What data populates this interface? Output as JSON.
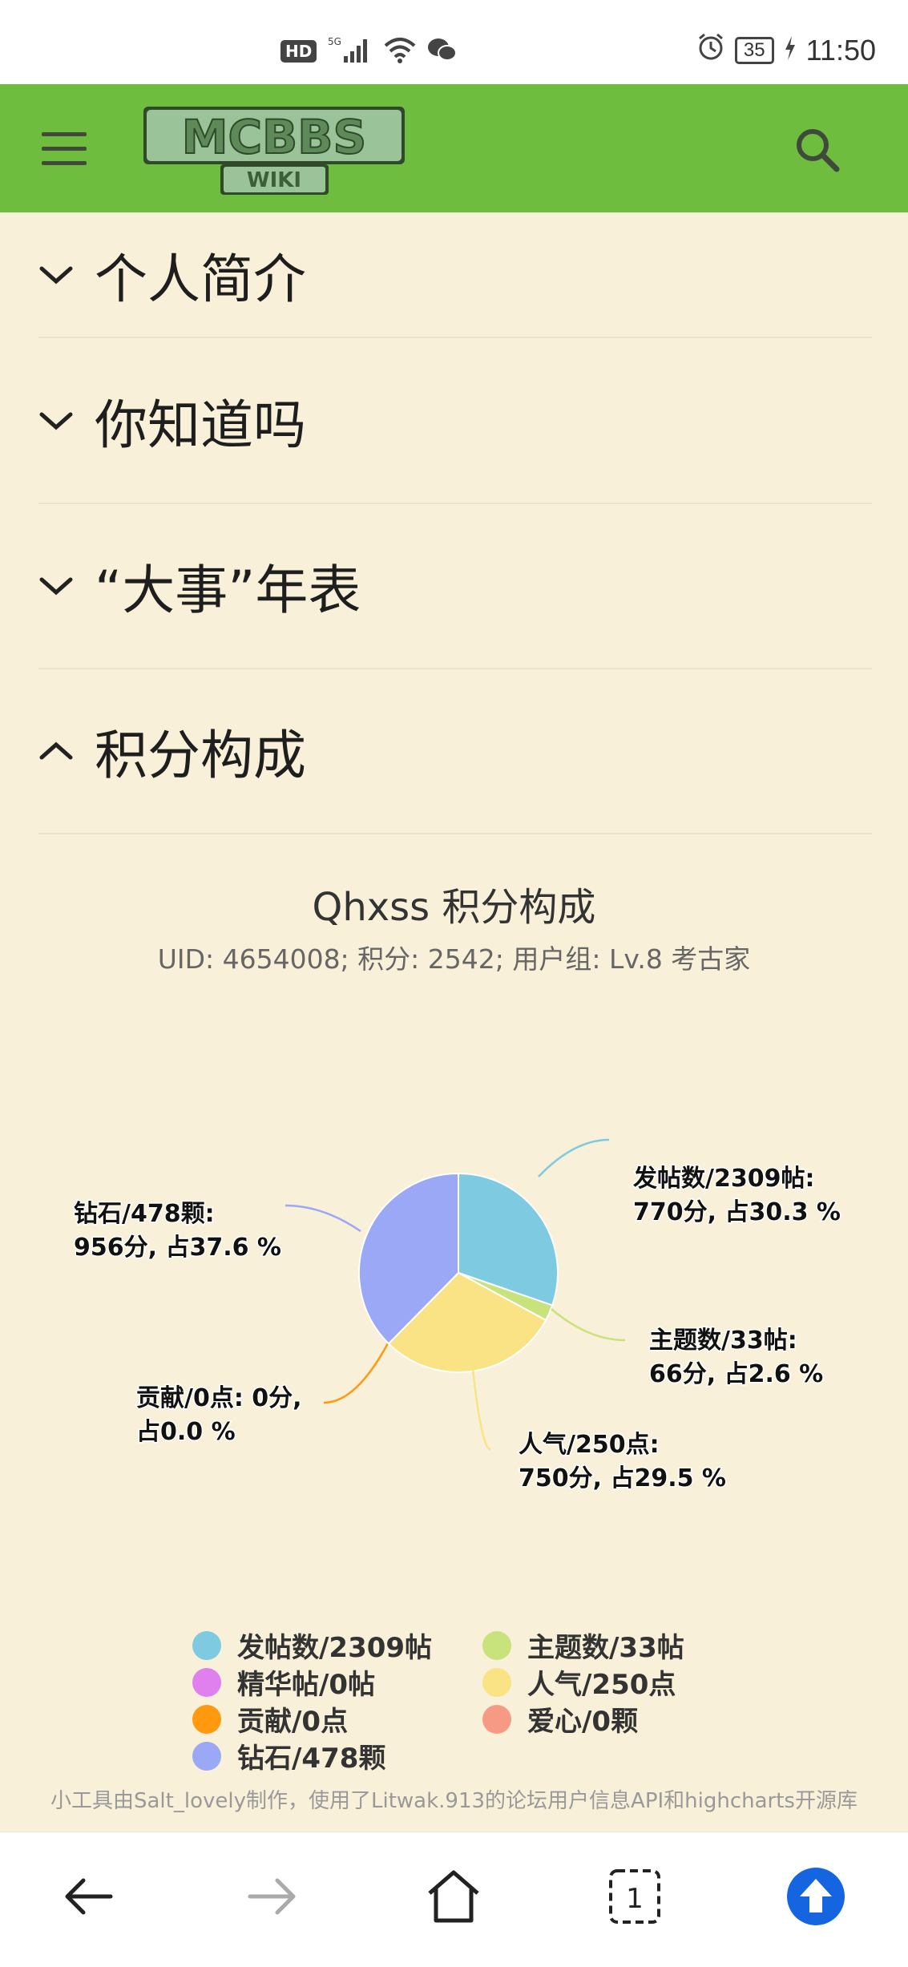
{
  "status_bar": {
    "network_badge": "HD",
    "signal_label": "5G",
    "battery": "35",
    "time": "11:50",
    "icons": [
      "hd-icon",
      "signal-icon",
      "wifi-icon",
      "wechat-icon",
      "alarm-icon",
      "battery-icon",
      "charging-icon"
    ]
  },
  "header": {
    "logo_text": "MCBBS",
    "logo_sub": "WIKI",
    "bg_color": "#6ebd3f",
    "icons": [
      "menu-icon",
      "search-icon"
    ]
  },
  "sections": [
    {
      "label": "个人简介",
      "expanded": false
    },
    {
      "label": "你知道吗",
      "expanded": false
    },
    {
      "label": "“大事”年表",
      "expanded": false
    },
    {
      "label": "积分构成",
      "expanded": true
    }
  ],
  "chart_data": {
    "type": "pie",
    "title": "Qhxss 积分构成",
    "subtitle": "UID: 4654008; 积分: 2542; 用户组: Lv.8 考古家",
    "slices": [
      {
        "name": "发帖数/2309帖",
        "points": 770,
        "percent": 30.3,
        "color": "#7ecae0",
        "label_line1": "发帖数/2309帖:",
        "label_line2": "770分, 占30.3 %"
      },
      {
        "name": "主题数/33帖",
        "points": 66,
        "percent": 2.6,
        "color": "#c8e27c",
        "label_line1": "主题数/33帖:",
        "label_line2": "66分, 占2.6 %"
      },
      {
        "name": "精华帖/0帖",
        "points": 0,
        "percent": 0.0,
        "color": "#e080ee"
      },
      {
        "name": "人气/250点",
        "points": 750,
        "percent": 29.5,
        "color": "#fae384",
        "label_line1": "人气/250点:",
        "label_line2": "750分, 占29.5 %"
      },
      {
        "name": "贡献/0点",
        "points": 0,
        "percent": 0.0,
        "color": "#ff9a10",
        "label_line1": "贡献/0点: 0分,",
        "label_line2": "占0.0 %"
      },
      {
        "name": "爱心/0颗",
        "points": 0,
        "percent": 0.0,
        "color": "#f79a85"
      },
      {
        "name": "钻石/478颗",
        "points": 956,
        "percent": 37.6,
        "color": "#9aa8f5",
        "label_line1": "钻石/478颗:",
        "label_line2": "956分, 占37.6 %"
      }
    ],
    "legend": [
      "发帖数/2309帖",
      "主题数/33帖",
      "精华帖/0帖",
      "人气/250点",
      "贡献/0点",
      "爱心/0颗",
      "钻石/478颗"
    ],
    "legend_placement": "bottom"
  },
  "credit": "小工具由Salt_lovely制作，使用了Litwak.913的论坛用户信息API和highcharts开源库",
  "bottom_nav": {
    "tab_count": "1",
    "icons": [
      "back-icon",
      "forward-icon",
      "home-icon",
      "tabs-icon",
      "scroll-top-icon"
    ]
  }
}
